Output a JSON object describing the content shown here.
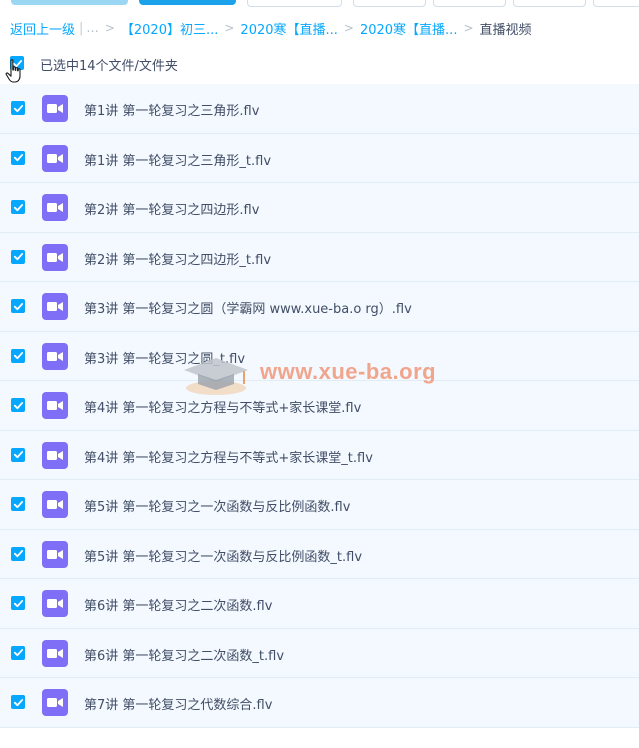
{
  "breadcrumb": {
    "back_label": "返回上一级",
    "ellipsis": "...",
    "items": [
      "【2020】初三...",
      "2020寒【直播...",
      "2020寒【直播..."
    ],
    "current": "直播视频"
  },
  "selection": {
    "text": "已选中14个文件/文件夹",
    "all_checked": true
  },
  "files": [
    {
      "name": "第1讲 第一轮复习之三角形.flv",
      "checked": true
    },
    {
      "name": "第1讲 第一轮复习之三角形_t.flv",
      "checked": true
    },
    {
      "name": "第2讲 第一轮复习之四边形.flv",
      "checked": true
    },
    {
      "name": "第2讲 第一轮复习之四边形_t.flv",
      "checked": true
    },
    {
      "name": "第3讲 第一轮复习之圆（学霸网 www.xue-ba.o rg）.flv",
      "checked": true
    },
    {
      "name": "第3讲 第一轮复习之圆_t.flv",
      "checked": true
    },
    {
      "name": "第4讲 第一轮复习之方程与不等式+家长课堂.flv",
      "checked": true
    },
    {
      "name": "第4讲 第一轮复习之方程与不等式+家长课堂_t.flv",
      "checked": true
    },
    {
      "name": "第5讲 第一轮复习之一次函数与反比例函数.flv",
      "checked": true
    },
    {
      "name": "第5讲 第一轮复习之一次函数与反比例函数_t.flv",
      "checked": true
    },
    {
      "name": "第6讲 第一轮复习之二次函数.flv",
      "checked": true
    },
    {
      "name": "第6讲 第一轮复习之二次函数_t.flv",
      "checked": true
    },
    {
      "name": "第7讲 第一轮复习之代数综合.flv",
      "checked": true
    }
  ],
  "watermark": {
    "text": "www.xue-ba.org"
  },
  "colors": {
    "accent": "#06a7ff",
    "video_icon": "#7f6ff7",
    "row_bg": "#f3f9fe",
    "watermark": "#f1a58c"
  }
}
